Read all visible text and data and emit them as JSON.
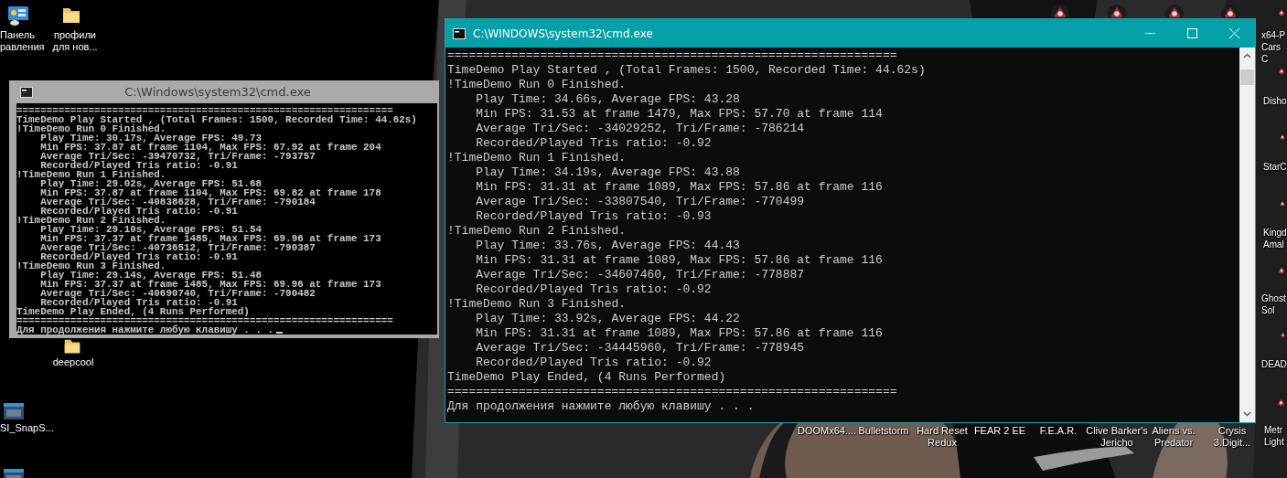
{
  "windows": [
    {
      "title": "C:\\Windows\\system32\\cmd.exe",
      "active": false,
      "cursor": true,
      "lines": [
        "===============================================================",
        "TimeDemo Play Started , (Total Frames: 1500, Recorded Time: 44.62s)",
        "!TimeDemo Run 0 Finished.",
        "    Play Time: 30.17s, Average FPS: 49.73",
        "    Min FPS: 37.87 at frame 1104, Max FPS: 67.92 at frame 204",
        "    Average Tri/Sec: -39470732, Tri/Frame: -793757",
        "    Recorded/Played Tris ratio: -0.91",
        "!TimeDemo Run 1 Finished.",
        "    Play Time: 29.02s, Average FPS: 51.68",
        "    Min FPS: 37.87 at frame 1104, Max FPS: 69.82 at frame 178",
        "    Average Tri/Sec: -40838628, Tri/Frame: -790184",
        "    Recorded/Played Tris ratio: -0.91",
        "!TimeDemo Run 2 Finished.",
        "    Play Time: 29.10s, Average FPS: 51.54",
        "    Min FPS: 37.37 at frame 1485, Max FPS: 69.96 at frame 173",
        "    Average Tri/Sec: -40736512, Tri/Frame: -790387",
        "    Recorded/Played Tris ratio: -0.91",
        "!TimeDemo Run 3 Finished.",
        "    Play Time: 29.14s, Average FPS: 51.48",
        "    Min FPS: 37.37 at frame 1485, Max FPS: 69.96 at frame 173",
        "    Average Tri/Sec: -40690740, Tri/Frame: -790482",
        "    Recorded/Played Tris ratio: -0.91",
        "TimeDemo Play Ended, (4 Runs Performed)",
        "===============================================================",
        "Для продолжения нажмите любую клавишу . . ."
      ]
    },
    {
      "title": "C:\\WINDOWS\\system32\\cmd.exe",
      "active": true,
      "cursor": false,
      "lines": [
        "===============================================================",
        "TimeDemo Play Started , (Total Frames: 1500, Recorded Time: 44.62s)",
        "!TimeDemo Run 0 Finished.",
        "    Play Time: 34.66s, Average FPS: 43.28",
        "    Min FPS: 31.53 at frame 1479, Max FPS: 57.70 at frame 114",
        "    Average Tri/Sec: -34029252, Tri/Frame: -786214",
        "    Recorded/Played Tris ratio: -0.92",
        "!TimeDemo Run 1 Finished.",
        "    Play Time: 34.19s, Average FPS: 43.88",
        "    Min FPS: 31.31 at frame 1089, Max FPS: 57.86 at frame 116",
        "    Average Tri/Sec: -33807540, Tri/Frame: -770499",
        "    Recorded/Played Tris ratio: -0.93",
        "!TimeDemo Run 2 Finished.",
        "    Play Time: 33.76s, Average FPS: 44.43",
        "    Min FPS: 31.31 at frame 1089, Max FPS: 57.86 at frame 116",
        "    Average Tri/Sec: -34607460, Tri/Frame: -778887",
        "    Recorded/Played Tris ratio: -0.92",
        "!TimeDemo Run 3 Finished.",
        "    Play Time: 33.92s, Average FPS: 44.22",
        "    Min FPS: 31.31 at frame 1089, Max FPS: 57.86 at frame 116",
        "    Average Tri/Sec: -34445960, Tri/Frame: -778945",
        "    Recorded/Played Tris ratio: -0.92",
        "TimeDemo Play Ended, (4 Runs Performed)",
        "===============================================================",
        "Для продолжения нажмите любую клавишу . . ."
      ]
    }
  ],
  "desktop_icons": [
    {
      "kind": "control-panel",
      "label": "Панель\nравления"
    },
    {
      "kind": "folder",
      "label": "профили\nдля нов..."
    },
    {
      "kind": "folder",
      "label": "deepcool"
    },
    {
      "kind": "app",
      "label": "SI_SnapS..."
    },
    {
      "kind": "app"
    },
    {
      "kind": "game"
    },
    {
      "kind": "game"
    },
    {
      "kind": "game"
    },
    {
      "kind": "game"
    },
    {
      "kind": "game",
      "label": "x64-P\nCars C"
    },
    {
      "kind": "game",
      "label": "Disho"
    },
    {
      "kind": "game",
      "label": "StarC"
    },
    {
      "kind": "game",
      "label": "Kingd\nAmal"
    },
    {
      "kind": "game",
      "label": "Ghost\nSol"
    },
    {
      "kind": "game",
      "label": "DEAD"
    },
    {
      "kind": "game",
      "label": "Metr\nLight"
    }
  ],
  "bottom_labels": [
    "DOOMx64....",
    "Bulletstorm",
    "Hard Reset\nRedux",
    "FEAR 2 EE",
    "F.E.A.R.",
    "Clive Barker's\nJericho",
    "Aliens vs.\nPredator",
    "Crysis\n3.Digit..."
  ]
}
